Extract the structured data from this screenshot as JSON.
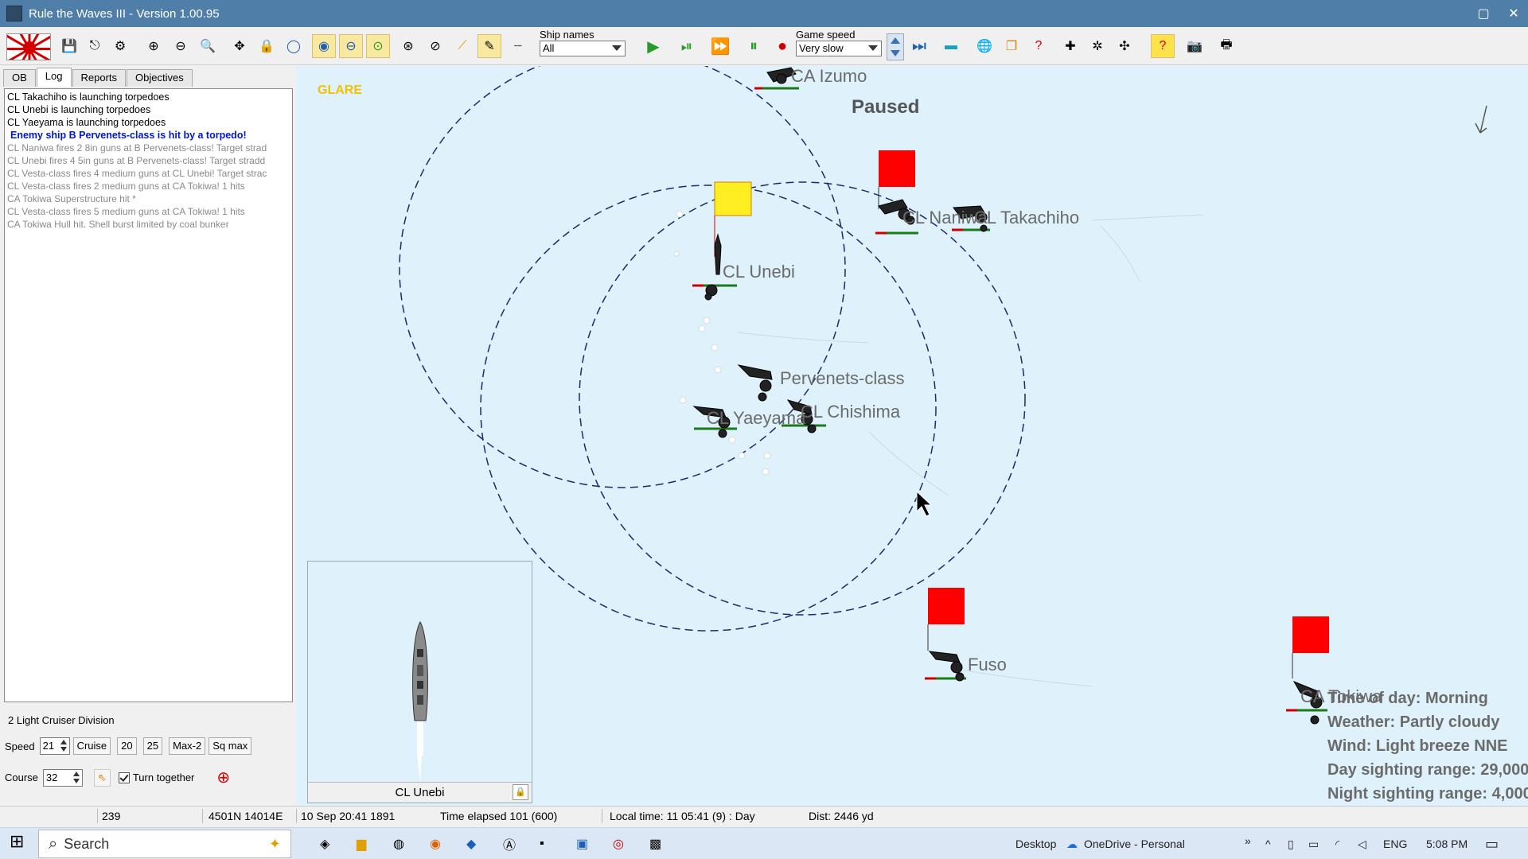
{
  "window": {
    "title": "Rule the Waves III - Version 1.00.95",
    "restore_glyph": "▢",
    "close_glyph": "✕"
  },
  "toolbar": {
    "ship_names_label": "Ship names",
    "ship_names_value": "All",
    "game_speed_label": "Game speed",
    "game_speed_value": "Very slow",
    "icons": [
      "save-icon",
      "exit-icon",
      "settings-icon",
      "zoom-in-icon",
      "zoom-out-icon",
      "zoom-fit-icon",
      "center-icon",
      "lock-icon",
      "circle-icon",
      "range-circle-icon",
      "minus-circle-icon",
      "target-circle-icon",
      "torpedo-icon",
      "compass-icon",
      "line-icon",
      "pencil-icon",
      "dashes-icon",
      "play-icon",
      "step-icon",
      "fast-forward-icon",
      "pause-icon",
      "record-icon",
      "fastest-icon",
      "map-icon",
      "globe-icon",
      "reports-icon",
      "help-chart-icon",
      "formation-icon",
      "gear-formation-icon",
      "scatter-icon",
      "help-icon",
      "camera-icon",
      "print-icon"
    ]
  },
  "tabs": [
    {
      "label": "OB"
    },
    {
      "label": "Log"
    },
    {
      "label": "Reports"
    },
    {
      "label": "Objectives"
    }
  ],
  "log": [
    {
      "text": "CL Takachiho is launching torpedoes",
      "style": "black"
    },
    {
      "text": "CL Unebi is launching torpedoes",
      "style": "black"
    },
    {
      "text": "CL Yaeyama is launching torpedoes",
      "style": "black"
    },
    {
      "text": "Enemy ship B Pervenets-class is hit by a torpedo!",
      "style": "blue"
    },
    {
      "text": "CL Naniwa fires 2 8in guns at B Pervenets-class! Target strad",
      "style": "gray"
    },
    {
      "text": "CL Unebi fires 4 5in guns at B Pervenets-class! Target stradd",
      "style": "gray"
    },
    {
      "text": "CL Vesta-class fires 4 medium guns at CL Unebi! Target strac",
      "style": "gray"
    },
    {
      "text": "CL Vesta-class fires 2 medium guns at CA Tokiwa! 1 hits",
      "style": "gray"
    },
    {
      "text": "CA Tokiwa Superstructure hit *",
      "style": "gray"
    },
    {
      "text": "CL Vesta-class fires 5 medium guns at CA Tokiwa! 1 hits",
      "style": "gray"
    },
    {
      "text": "CA Tokiwa Hull hit. Shell burst limited by coal bunker",
      "style": "gray"
    }
  ],
  "division": {
    "name": "2 Light Cruiser Division",
    "speed_label": "Speed",
    "speed_value": "21",
    "cruise_label": "Cruise",
    "btn_20": "20",
    "btn_25": "25",
    "max2_label": "Max-2",
    "sqmax_label": "Sq max",
    "course_label": "Course",
    "course_value": "32",
    "turn_together_label": "Turn together"
  },
  "map": {
    "glare": "GLARE",
    "paused": "Paused",
    "ships": [
      {
        "name": "CA Izumo"
      },
      {
        "name": "CL Naniwa"
      },
      {
        "name": "CL Takachiho"
      },
      {
        "name": "CL Unebi"
      },
      {
        "name": "Pervenets-class"
      },
      {
        "name": "CL Yaeyama"
      },
      {
        "name": "CL Chishima"
      },
      {
        "name": "Fuso"
      },
      {
        "name": "CA Tokiwa"
      }
    ],
    "info": {
      "time_of_day": "Time of day: Morning",
      "weather": "Weather: Partly cloudy",
      "wind": "Wind: Light breeze  NNE",
      "day_range": "Day sighting range: 29,000",
      "night_range": "Night sighting range: 4,000"
    },
    "colors": {
      "sea": "#dff2fb",
      "enemy_flag": "#ff0000",
      "own_flag": "#ffee22",
      "range_ring": "#1a2a6e"
    }
  },
  "preview": {
    "ship_name": "CL Unebi"
  },
  "status": {
    "heading": "239",
    "position": "4501N 14014E",
    "date": "10 Sep 20:41 1891",
    "elapsed": "Time elapsed 101 (600)",
    "local": "Local time: 11 05:41 (9) : Day",
    "dist": "Dist: 2446 yd"
  },
  "taskbar": {
    "search": "Search",
    "desktop": "Desktop",
    "onedrive": "OneDrive - Personal",
    "chevron": "»",
    "lang": "ENG",
    "time": "5:08 PM"
  }
}
